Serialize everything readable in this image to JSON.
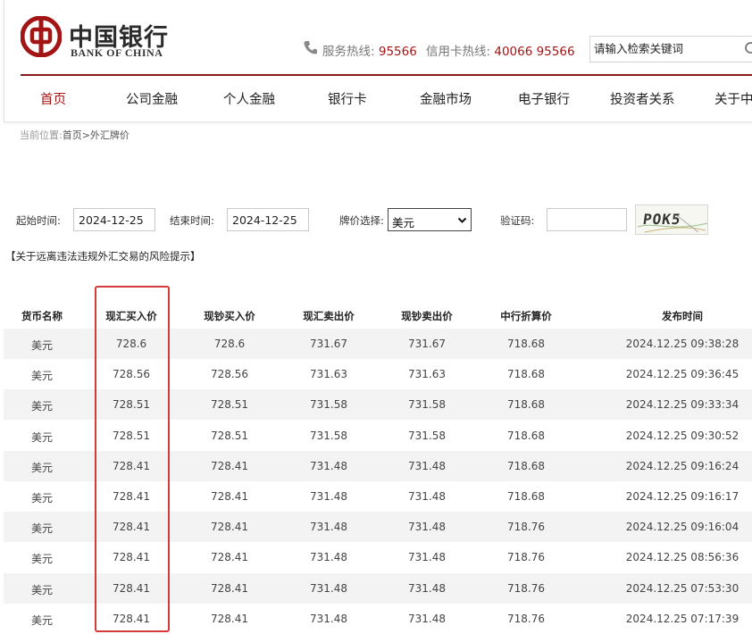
{
  "brand": {
    "name_cn": "中国银行",
    "name_en": "BANK OF CHINA",
    "color": "#a31515"
  },
  "hotlines": [
    {
      "label": "服务热线:",
      "number": "95566"
    },
    {
      "label": "信用卡热线:",
      "number": "40066 95566"
    }
  ],
  "search": {
    "placeholder": "请输入检索关键词"
  },
  "nav": [
    {
      "label": "首页",
      "active": true
    },
    {
      "label": "公司金融"
    },
    {
      "label": "个人金融"
    },
    {
      "label": "银行卡"
    },
    {
      "label": "金融市场"
    },
    {
      "label": "电子银行"
    },
    {
      "label": "投资者关系"
    },
    {
      "label": "关于中"
    }
  ],
  "breadcrumb": {
    "prefix": "当前位置:",
    "path": "首页>外汇牌价"
  },
  "filters": {
    "start_label": "起始时间:",
    "start_value": "2024-12-25",
    "end_label": "结束时间:",
    "end_value": "2024-12-25",
    "currency_label": "牌价选择:",
    "currency_value": "美元",
    "captcha_label": "验证码:",
    "captcha_value": "",
    "captcha_image_text": "POK5"
  },
  "risk_notice": "【关于远离违法违规外汇交易的风险提示】",
  "table": {
    "headers": [
      "货币名称",
      "现汇买入价",
      "现钞买入价",
      "现汇卖出价",
      "现钞卖出价",
      "中行折算价",
      "发布时间"
    ],
    "rows": [
      [
        "美元",
        "728.6",
        "728.6",
        "731.67",
        "731.67",
        "718.68",
        "2024.12.25 09:38:28"
      ],
      [
        "美元",
        "728.56",
        "728.56",
        "731.63",
        "731.63",
        "718.68",
        "2024.12.25 09:36:45"
      ],
      [
        "美元",
        "728.51",
        "728.51",
        "731.58",
        "731.58",
        "718.68",
        "2024.12.25 09:33:34"
      ],
      [
        "美元",
        "728.51",
        "728.51",
        "731.58",
        "731.58",
        "718.68",
        "2024.12.25 09:30:52"
      ],
      [
        "美元",
        "728.41",
        "728.41",
        "731.48",
        "731.48",
        "718.68",
        "2024.12.25 09:16:24"
      ],
      [
        "美元",
        "728.41",
        "728.41",
        "731.48",
        "731.48",
        "718.68",
        "2024.12.25 09:16:17"
      ],
      [
        "美元",
        "728.41",
        "728.41",
        "731.48",
        "731.48",
        "718.76",
        "2024.12.25 09:16:04"
      ],
      [
        "美元",
        "728.41",
        "728.41",
        "731.48",
        "731.48",
        "718.76",
        "2024.12.25 08:56:36"
      ],
      [
        "美元",
        "728.41",
        "728.41",
        "731.48",
        "731.48",
        "718.76",
        "2024.12.25 07:53:30"
      ],
      [
        "美元",
        "728.41",
        "728.41",
        "731.48",
        "731.48",
        "718.76",
        "2024.12.25 07:17:39"
      ]
    ]
  },
  "icons": [
    "boc-logo-icon",
    "phone-icon",
    "search-icon",
    "chevron-down-icon"
  ],
  "highlight_color": "#d63a3a"
}
